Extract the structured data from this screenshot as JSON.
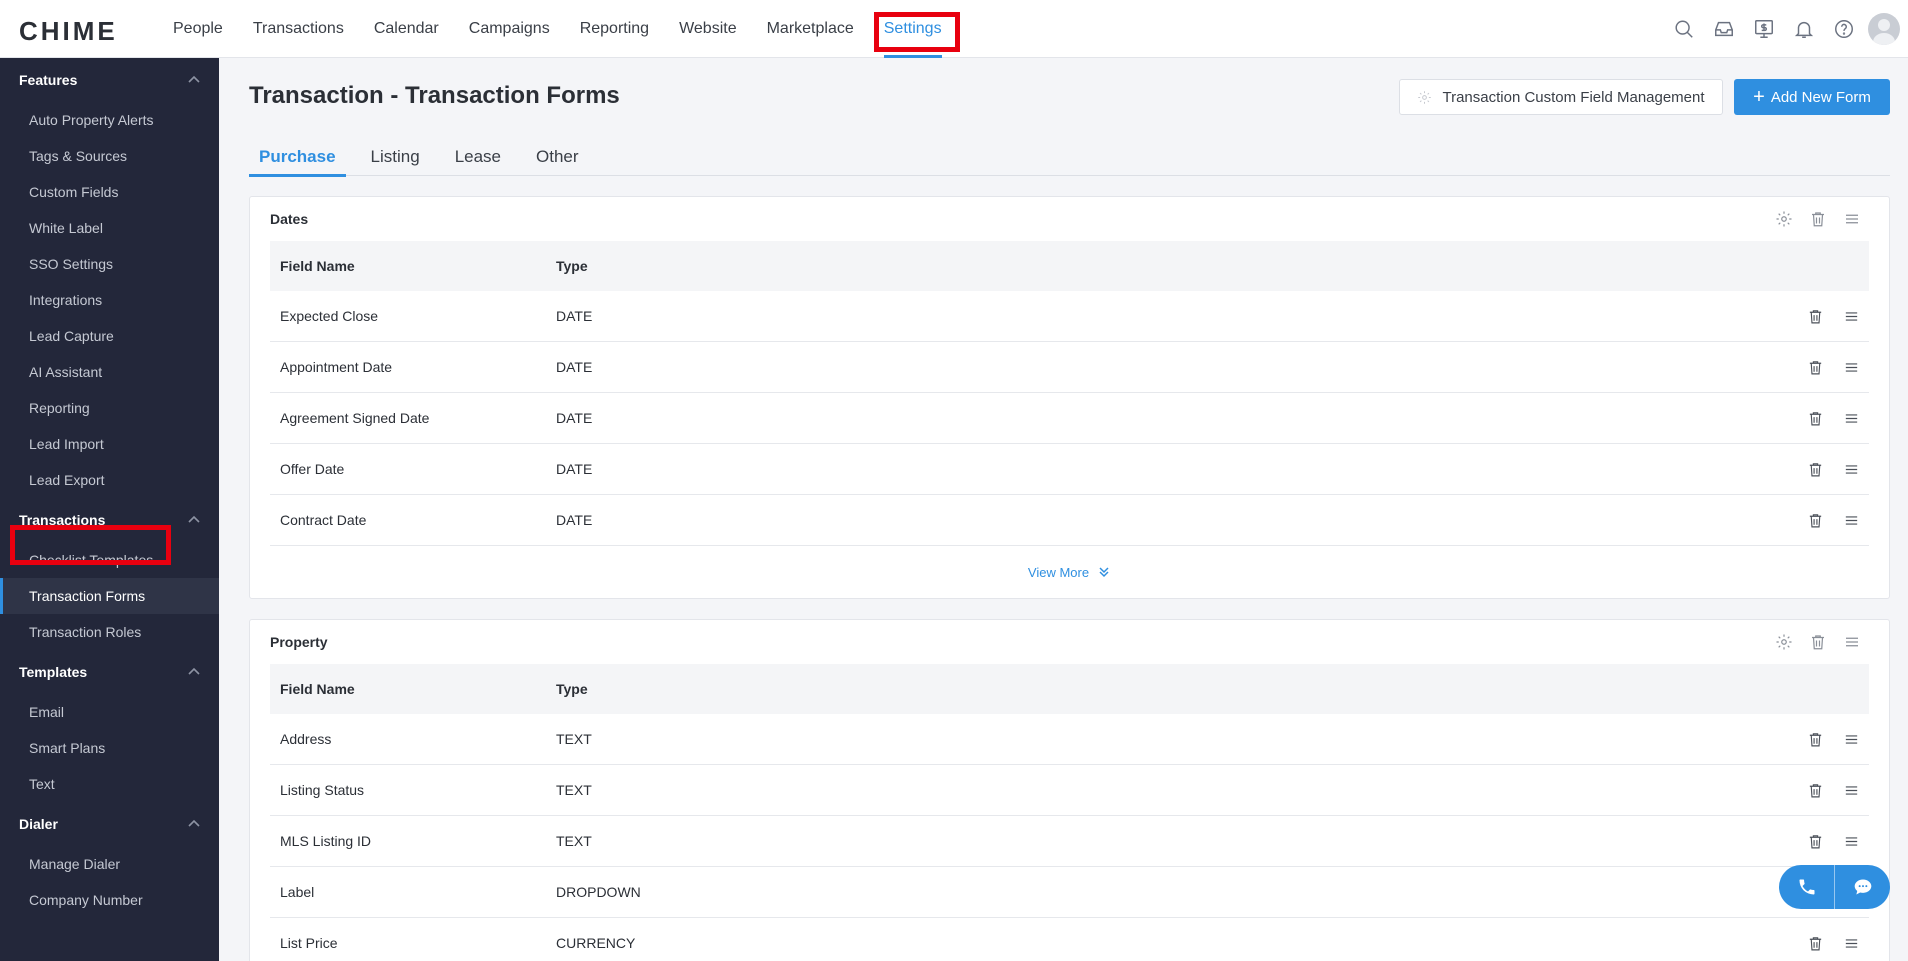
{
  "app": {
    "logo": "CHIME"
  },
  "nav": {
    "items": [
      "People",
      "Transactions",
      "Calendar",
      "Campaigns",
      "Reporting",
      "Website",
      "Marketplace",
      "Settings"
    ],
    "active": "Settings",
    "icons": [
      "search-icon",
      "inbox-icon",
      "billing-icon",
      "bell-icon",
      "help-icon",
      "user-avatar"
    ]
  },
  "sidebar": {
    "sections": [
      {
        "title": "Features",
        "items": [
          "Auto Property Alerts",
          "Tags & Sources",
          "Custom Fields",
          "White Label",
          "SSO Settings",
          "Integrations",
          "Lead Capture",
          "AI Assistant",
          "Reporting",
          "Lead Import",
          "Lead Export"
        ]
      },
      {
        "title": "Transactions",
        "items": [
          "Checklist Templates",
          "Transaction Forms",
          "Transaction Roles"
        ]
      },
      {
        "title": "Templates",
        "items": [
          "Email",
          "Smart Plans",
          "Text"
        ]
      },
      {
        "title": "Dialer",
        "items": [
          "Manage Dialer",
          "Company Number"
        ]
      }
    ],
    "active_item": "Transaction Forms"
  },
  "page": {
    "title": "Transaction - Transaction Forms",
    "custom_field_button": "Transaction Custom Field Management",
    "add_button": "Add New Form",
    "tabs": [
      "Purchase",
      "Listing",
      "Lease",
      "Other"
    ],
    "active_tab": "Purchase"
  },
  "cards": [
    {
      "title": "Dates",
      "headers": {
        "name": "Field Name",
        "type": "Type"
      },
      "rows": [
        {
          "name": "Expected Close",
          "type": "DATE"
        },
        {
          "name": "Appointment Date",
          "type": "DATE"
        },
        {
          "name": "Agreement Signed Date",
          "type": "DATE"
        },
        {
          "name": "Offer Date",
          "type": "DATE"
        },
        {
          "name": "Contract Date",
          "type": "DATE"
        }
      ],
      "view_more": "View More"
    },
    {
      "title": "Property",
      "headers": {
        "name": "Field Name",
        "type": "Type"
      },
      "rows": [
        {
          "name": "Address",
          "type": "TEXT"
        },
        {
          "name": "Listing Status",
          "type": "TEXT"
        },
        {
          "name": "MLS Listing ID",
          "type": "TEXT"
        },
        {
          "name": "Label",
          "type": "DROPDOWN"
        },
        {
          "name": "List Price",
          "type": "CURRENCY"
        }
      ]
    }
  ],
  "colors": {
    "accent": "#2f8fe0",
    "sidebar_bg": "#23273a",
    "highlight": "#e8000f"
  }
}
